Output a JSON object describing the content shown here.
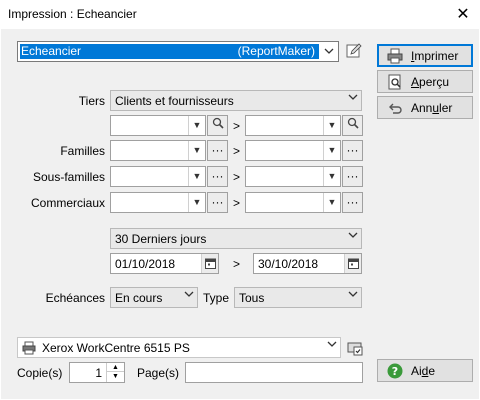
{
  "window": {
    "title": "Impression : Echeancier",
    "close_glyph": "✕"
  },
  "report": {
    "name": "Echeancier",
    "tag": "(ReportMaker)",
    "edit_icon": "edit-icon"
  },
  "buttons": {
    "print": {
      "label_pre": "",
      "label_mn": "I",
      "label_post": "mprimer",
      "icon": "printer-icon"
    },
    "preview": {
      "label_pre": "",
      "label_mn": "A",
      "label_post": "perçu",
      "icon": "preview-icon"
    },
    "cancel": {
      "label_pre": "Ann",
      "label_mn": "u",
      "label_post": "ler",
      "icon": "undo-icon"
    },
    "help": {
      "label_pre": "Ai",
      "label_mn": "d",
      "label_post": "e",
      "icon": "help-icon"
    }
  },
  "filters": {
    "tiers_label": "Tiers",
    "tiers_value": "Clients et fournisseurs",
    "familles_label": "Familles",
    "sousfamilles_label": "Sous-familles",
    "commerciaux_label": "Commerciaux",
    "range_sep": ">",
    "more_glyph": "···"
  },
  "period": {
    "value": "30 Derniers jours",
    "date_from": "01/10/2018",
    "date_to": "30/10/2018",
    "sep": ">"
  },
  "echeances": {
    "label": "Echéances",
    "value": "En cours",
    "type_label": "Type",
    "type_value": "Tous"
  },
  "printer": {
    "name": "Xerox WorkCentre 6515 PS",
    "copies_label": "Copie(s)",
    "copies_value": "1",
    "pages_label": "Page(s)",
    "pages_value": ""
  },
  "colors": {
    "accent": "#0078d7",
    "dialog_bg": "#f0f0f0",
    "help_green": "#3a9a3a"
  }
}
